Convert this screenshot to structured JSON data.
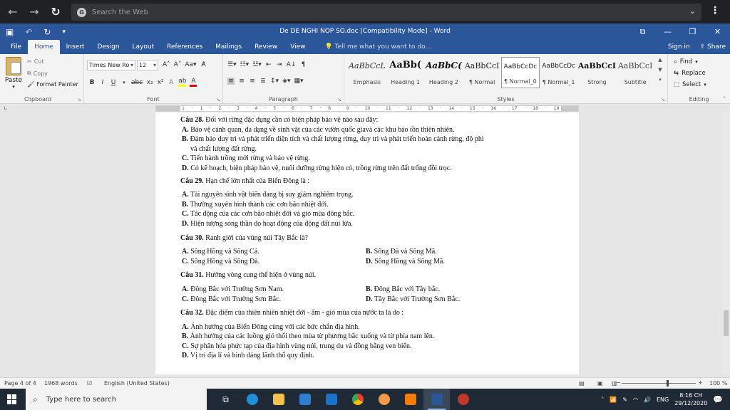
{
  "browser": {
    "search_placeholder": "Search the Web"
  },
  "window": {
    "title": "De DE NGHI NOP SO.doc [Compatibility Mode] - Word",
    "controls": [
      "⧉",
      "—",
      "❐",
      "✕"
    ]
  },
  "tabs": [
    "File",
    "Home",
    "Insert",
    "Design",
    "Layout",
    "References",
    "Mailings",
    "Review",
    "View"
  ],
  "tell_me": "Tell me what you want to do...",
  "sign_in": "Sign in",
  "share": "Share",
  "clipboard": {
    "paste": "Paste",
    "cut": "Cut",
    "copy": "Copy",
    "format_painter": "Format Painter",
    "label": "Clipboard"
  },
  "font": {
    "name": "Times New Ro",
    "size": "12",
    "label": "Font"
  },
  "paragraph": {
    "label": "Paragraph"
  },
  "styles": {
    "label": "Styles",
    "items": [
      {
        "sample": "AaBbCcL",
        "name": "Emphasis"
      },
      {
        "sample": "AaBb(",
        "name": "Heading 1"
      },
      {
        "sample": "AaBbC(",
        "name": "Heading 2"
      },
      {
        "sample": "AaBbCcI",
        "name": "¶ Normal"
      },
      {
        "sample": "AaBbCcDc",
        "name": "¶ Normal_0"
      },
      {
        "sample": "AaBbCcDc",
        "name": "¶ Normal_1"
      },
      {
        "sample": "AaBbCcI",
        "name": "Strong"
      },
      {
        "sample": "AaBbCcI",
        "name": "Subtitle"
      }
    ]
  },
  "editing": {
    "find": "Find",
    "replace": "Replace",
    "select": "Select",
    "label": "Editing"
  },
  "ruler": {
    "numbers": [
      "1",
      "·",
      "1",
      "·",
      "2",
      "·",
      "3",
      "·",
      "4",
      "·",
      "5",
      "·",
      "6",
      "·",
      "7",
      "·",
      "8",
      "·",
      "9",
      "·",
      "10",
      "·",
      "11",
      "·",
      "12",
      "·",
      "13",
      "·",
      "14",
      "·",
      "15",
      "·",
      "16",
      "·",
      "17",
      "·",
      "18",
      "·",
      "19"
    ]
  },
  "document": {
    "q28": {
      "head": "Câu 28.",
      "text": " Đối với rừng đặc dụng cần có biện pháp bảo vệ nào sau đây:"
    },
    "q28_opts": [
      {
        "key": "A.",
        "text": " Bảo vệ cảnh quan, đa dạng về sinh vật của các vườn quốc giavà các khu bảo tồn thiên nhiên."
      },
      {
        "key": "B.",
        "text": " Đảm bảo duy trì và phát triển diện tích và chất lượng rừng, duy trì và phát triển hoàn cảnh rừng, độ phì"
      },
      {
        "key": "",
        "text": "và chất lượng đất rừng."
      },
      {
        "key": "C.",
        "text": " Tiến hành trồng mới rừng và bảo vệ rừng."
      },
      {
        "key": "D.",
        "text": " Có kế hoạch, biện pháp bảo vệ, nuôi dưỡng rừng hiện có, trồng rừng trên đất trống đồi trọc."
      }
    ],
    "q29": {
      "head": "Câu 29.",
      "text": " Hạn chế lớn nhất của Biển Đông là :"
    },
    "q29_opts": [
      {
        "key": "A.",
        "text": " Tài nguyên sinh vật biển đang bị suy giảm nghiêm trọng."
      },
      {
        "key": "B.",
        "text": " Thường xuyên hình thành các cơn bão nhiệt đới."
      },
      {
        "key": "C.",
        "text": " Tác động của các cơn bão nhiệt đới và gió mùa đông bắc."
      },
      {
        "key": "D.",
        "text": " Hiện tượng sóng thần do hoạt động của động đất núi lửa."
      }
    ],
    "q30": {
      "head": "Câu 30.",
      "text": " Ranh giới của vùng núi Tây Bắc là?"
    },
    "q30_opts": [
      {
        "k1": "A.",
        "t1": " Sông Hồng và Sông Cả.",
        "k2": "B.",
        "t2": " Sông Đà và Sông Mã."
      },
      {
        "k1": "C.",
        "t1": " Sông Hồng và Sông Đà.",
        "k2": "D.",
        "t2": " Sông Hồng và Sông Mã."
      }
    ],
    "q31": {
      "head": "Câu 31.",
      "text": " Hướng vòng cung thể hiện ở vùng núi."
    },
    "q31_opts": [
      {
        "k1": "A.",
        "t1": " Đông Bắc với Trường Sơn Nam.",
        "k2": "B.",
        "t2": " Đông Bắc với Tây bắc."
      },
      {
        "k1": "C.",
        "t1": " Đông Bắc với Trường Sơn Bắc.",
        "k2": "D.",
        "t2": " Tây Bắc với Trường Sơn Bắc."
      }
    ],
    "q32": {
      "head": "Câu 32.",
      "text": " Đặc điểm của thiên nhiên nhiệt đới - ẩm - gió mùa của nước ta là do :"
    },
    "q32_opts": [
      {
        "key": "A.",
        "text": " Ảnh hưởng của Biển Đông cùng với các bức chắn địa hình."
      },
      {
        "key": "B.",
        "text": " Ảnh hưởng của các luồng gió thổi theo mùa từ phương bắc xuống và từ phía nam lên."
      },
      {
        "key": "C.",
        "text": " Sự phân hóa phức tạp của địa hình vùng núi, trung du và đồng bằng ven biển."
      },
      {
        "key": "D.",
        "text": " Vị trí địa lí và hình dáng lãnh thổ quy định."
      }
    ]
  },
  "status": {
    "page": "Page 4 of 4",
    "words": "1968 words",
    "language": "English (United States)",
    "zoom": "100 %"
  },
  "taskbar": {
    "search_placeholder": "Type here to search",
    "lang": "ENG",
    "time": "8:16 CH",
    "date": "29/12/2020"
  },
  "colors": {
    "word_blue": "#2b579a",
    "taskbar": "#1f2a36"
  }
}
